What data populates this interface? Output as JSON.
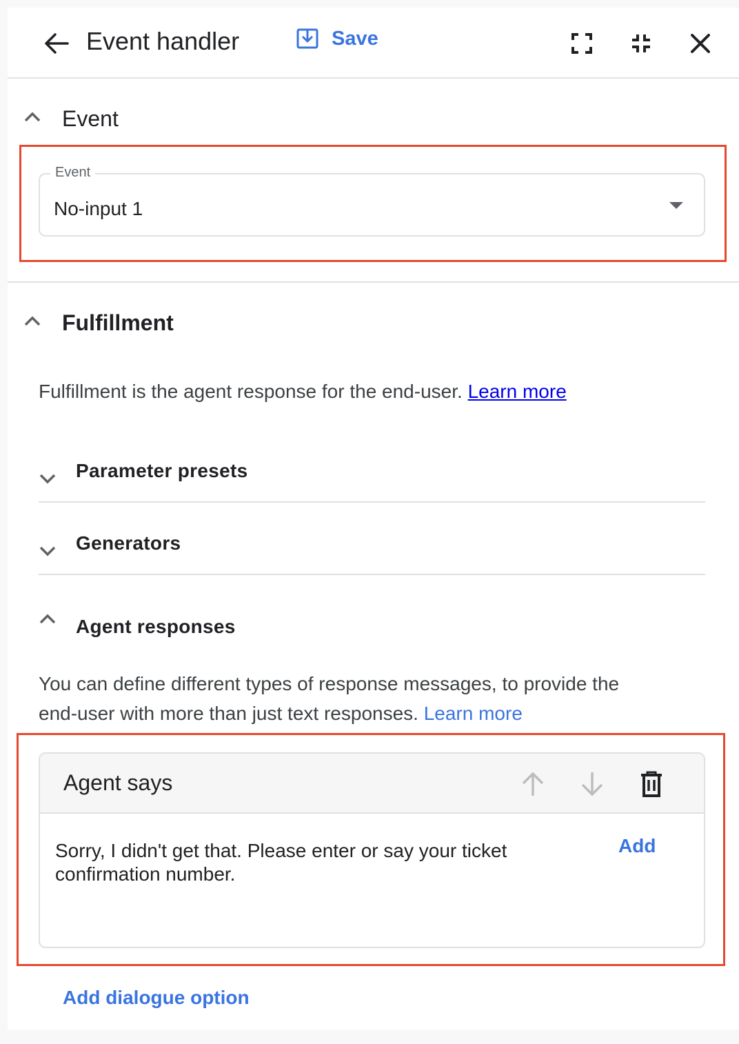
{
  "header": {
    "title": "Event handler",
    "save_label": "Save",
    "icons": [
      "back-arrow-icon",
      "save-icon",
      "fullscreen-icon",
      "fullscreen-exit-icon",
      "close-icon"
    ]
  },
  "event_section": {
    "title": "Event",
    "select": {
      "label": "Event",
      "value": "No-input 1"
    }
  },
  "fulfillment_section": {
    "title": "Fulfillment",
    "description": "Fulfillment is the agent response for the end-user.",
    "learn_more": "Learn more",
    "subsections": [
      {
        "label": "Parameter presets",
        "expanded": false
      },
      {
        "label": "Generators",
        "expanded": false
      },
      {
        "label": "Agent responses",
        "expanded": true
      }
    ],
    "agent_responses": {
      "description_line1": "You can define different types of response messages, to provide the",
      "description_line2": "end-user with more than just text responses.",
      "learn_more": "Learn more",
      "card": {
        "title": "Agent says",
        "text": "Sorry, I didn't get that. Please enter or say your ticket confirmation number.",
        "add_label": "Add"
      }
    },
    "add_dialogue_option": "Add dialogue option"
  },
  "colors": {
    "accent": "#3a74e0",
    "highlight": "#e8472f",
    "link": "#0000ee"
  }
}
